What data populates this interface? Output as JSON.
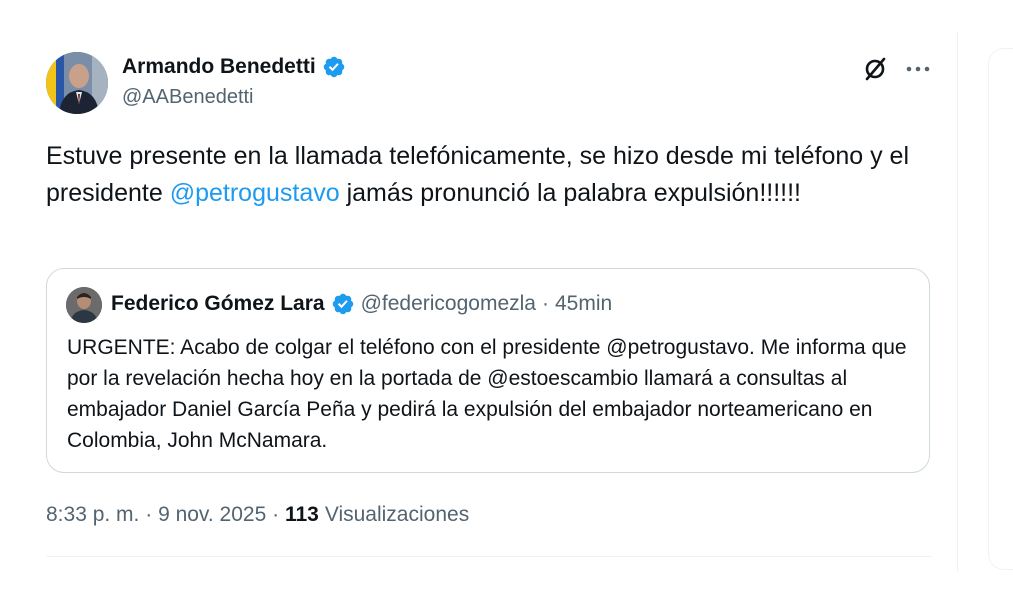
{
  "author": {
    "name": "Armando Benedetti",
    "handle": "@AABenedetti"
  },
  "tweet": {
    "text_before": "Estuve presente en la llamada telefónicamente, se hizo desde mi teléfono y el presidente ",
    "mention": "@petrogustavo",
    "text_after": " jamás pronunció la palabra expulsión!!!!!!"
  },
  "quoted": {
    "name": "Federico Gómez Lara",
    "handle": "@federicogomezla",
    "separator": " · ",
    "time": "45min",
    "text": "URGENTE: Acabo de colgar el teléfono con el presidente @petrogustavo. Me informa que por la revelación hecha hoy en la portada de @estoescambio llamará a consultas al embajador Daniel García Peña y pedirá la expulsión del embajador norteamericano en Colombia, John McNamara."
  },
  "meta": {
    "time": "8:33 p. m.",
    "sep1": " · ",
    "date": "9 nov. 2025",
    "sep2": " · ",
    "views_count": "113",
    "views_label": "Visualizaciones"
  },
  "colors": {
    "accent": "#1d9bf0",
    "verified": "#1d9bf0",
    "secondary_text": "#536471",
    "border": "#cfd9de"
  },
  "icons": {
    "verified": "verified-badge-icon",
    "grok": "grok-icon",
    "more": "more-horizontal-icon"
  }
}
